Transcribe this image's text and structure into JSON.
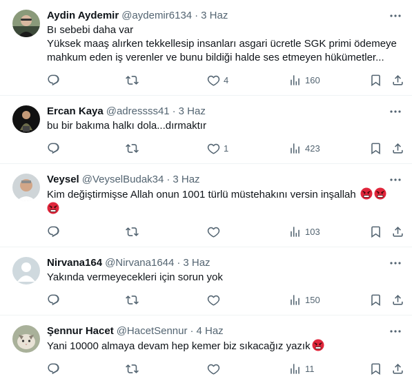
{
  "tweets": [
    {
      "name": "Aydin Aydemir",
      "handle": "@aydemir6134",
      "dot": "·",
      "time": "3 Haz",
      "text": "Bı sebebi daha var\nYüksek maaş alırken tekkellesip insanları asgari ücretle SGK primi ödemeye mahkum eden iş verenler ve bunu bildiği halde ses etmeyen hükümetler...",
      "reply_count": "",
      "retweet_count": "",
      "like_count": "4",
      "view_count": "160",
      "emojis": 0
    },
    {
      "name": "Ercan Kaya",
      "handle": "@adressss41",
      "dot": "·",
      "time": "3 Haz",
      "text": "bu bir bakıma halkı dola...dırmaktır",
      "reply_count": "",
      "retweet_count": "",
      "like_count": "1",
      "view_count": "423",
      "emojis": 0
    },
    {
      "name": "Veysel",
      "handle": "@VeyselBudak34",
      "dot": "·",
      "time": "3 Haz",
      "text": "Kim değiştirmişse Allah onun 1001 türlü müstehakını versin inşallah",
      "reply_count": "",
      "retweet_count": "",
      "like_count": "",
      "view_count": "103",
      "emojis": 3
    },
    {
      "name": "Nirvana164",
      "handle": "@Nirvana1644",
      "dot": "·",
      "time": "3 Haz",
      "text": "Yakında vermeyecekleri için sorun yok",
      "reply_count": "",
      "retweet_count": "",
      "like_count": "",
      "view_count": "150",
      "emojis": 0
    },
    {
      "name": "Şennur Hacet",
      "handle": "@HacetSennur",
      "dot": "·",
      "time": "4 Haz",
      "text": "Yani 10000 almaya devam hep kemer biz sıkacağız yazık",
      "reply_count": "",
      "retweet_count": "",
      "like_count": "",
      "view_count": "11",
      "emojis": 1
    }
  ],
  "icons": {
    "reply": "reply-icon",
    "retweet": "retweet-icon",
    "like": "heart-icon",
    "views": "views-chart-icon",
    "bookmark": "bookmark-icon",
    "share": "share-icon",
    "more": "more-dots-icon",
    "emoji": "angry-face-emoji"
  },
  "colors": {
    "text": "#0f1419",
    "secondary": "#536471",
    "divider": "#eff3f4",
    "emoji_red": "#e0263b"
  }
}
